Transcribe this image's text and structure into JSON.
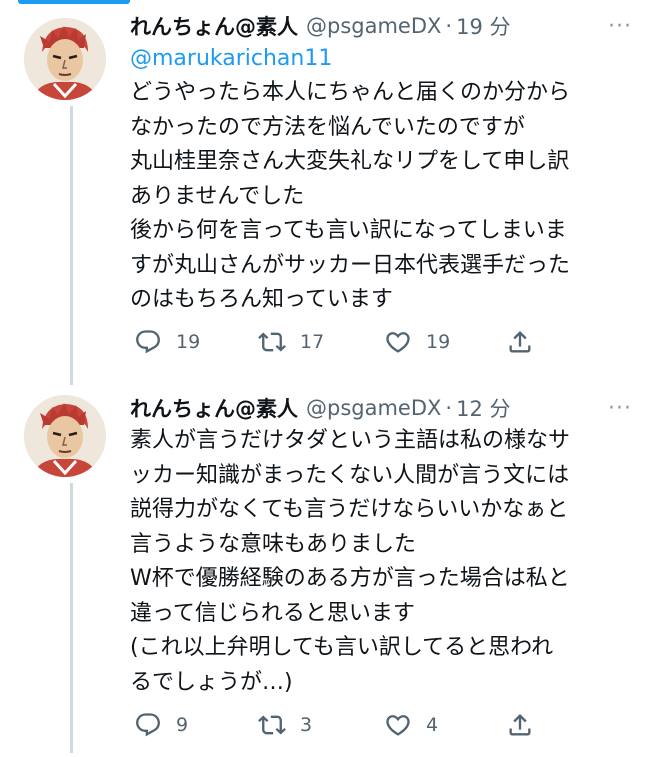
{
  "tweets": [
    {
      "display_name": "れんちょん@素人",
      "handle": "@psgameDX",
      "separator": "·",
      "time": "19 分",
      "more": "···",
      "mention": "@marukarichan11",
      "lines": [
        "どうやったら本人にちゃんと届くのか分から",
        "なかったので方法を悩んでいたのですが",
        "丸山桂里奈さん大変失礼なリプをして申し訳",
        "ありませんでした",
        "後から何を言っても言い訳になってしまいま",
        "すが丸山さんがサッカー日本代表選手だった",
        "のはもちろん知っています"
      ],
      "replies": "19",
      "retweets": "17",
      "likes": "19",
      "icons": {
        "reply": "reply-icon",
        "retweet": "retweet-icon",
        "like": "heart-icon",
        "share": "share-icon"
      }
    },
    {
      "display_name": "れんちょん@素人",
      "handle": "@psgameDX",
      "separator": "·",
      "time": "12 分",
      "more": "···",
      "lines": [
        "素人が言うだけタダという主語は私の様なサ",
        "ッカー知識がまったくない人間が言う文には",
        "説得力がなくても言うだけならいいかなぁと",
        "言うような意味もありました",
        "W杯で優勝経験のある方が言った場合は私と",
        "違って信じられると思います",
        "(これ以上弁明しても言い訳してると思われ",
        "るでしょうが…)"
      ],
      "replies": "9",
      "retweets": "3",
      "likes": "4",
      "icons": {
        "reply": "reply-icon",
        "retweet": "retweet-icon",
        "like": "heart-icon",
        "share": "share-icon"
      }
    }
  ],
  "colors": {
    "accent": "#1d9bf0",
    "text": "#0f1419",
    "muted": "#536471",
    "thread_line": "#cfd9de"
  }
}
